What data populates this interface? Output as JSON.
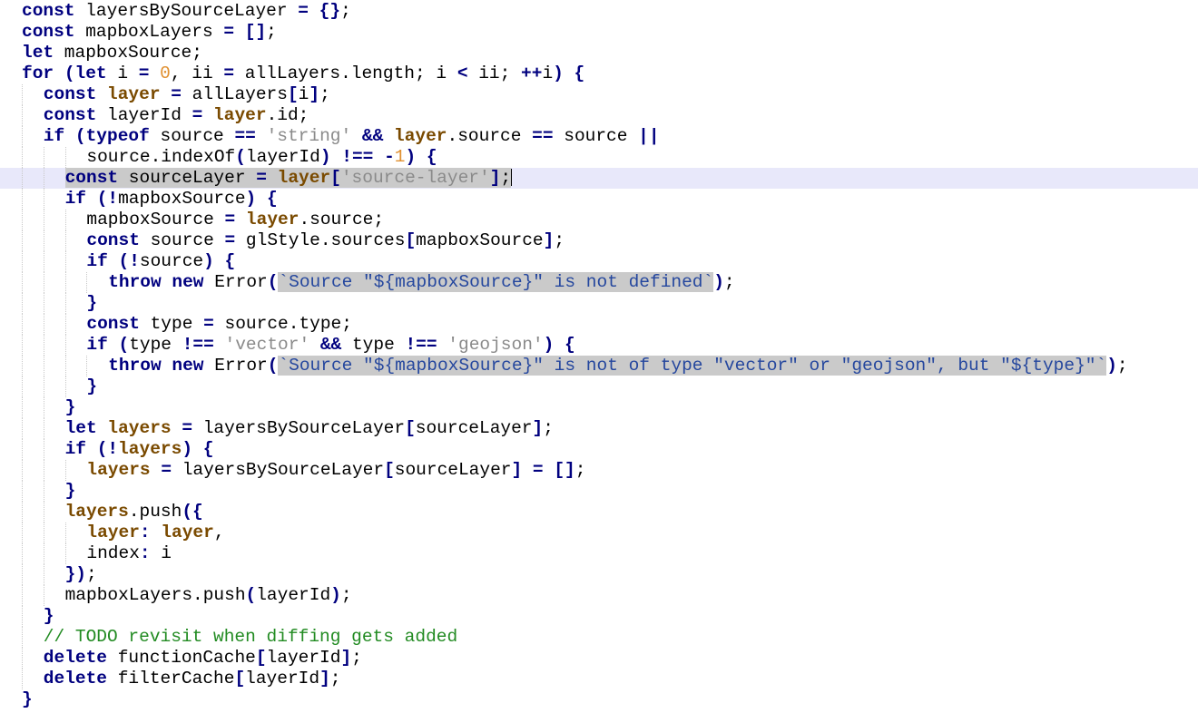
{
  "editor": {
    "current_line": 8,
    "lines": [
      {
        "indent": 0,
        "tokens": [
          [
            "kw",
            "const"
          ],
          [
            "id",
            " layersBySourceLayer "
          ],
          [
            "op",
            "="
          ],
          [
            "pr",
            " "
          ],
          [
            "op",
            "{}"
          ],
          [
            "pr",
            ";"
          ]
        ]
      },
      {
        "indent": 0,
        "tokens": [
          [
            "kw",
            "const"
          ],
          [
            "id",
            " mapboxLayers "
          ],
          [
            "op",
            "="
          ],
          [
            "pr",
            " "
          ],
          [
            "op",
            "[]"
          ],
          [
            "pr",
            ";"
          ]
        ]
      },
      {
        "indent": 0,
        "tokens": [
          [
            "kw",
            "let"
          ],
          [
            "id",
            " mapboxSource"
          ],
          [
            "pr",
            ";"
          ]
        ]
      },
      {
        "indent": 0,
        "tokens": [
          [
            "kw",
            "for"
          ],
          [
            "pr",
            " "
          ],
          [
            "op",
            "("
          ],
          [
            "kw",
            "let"
          ],
          [
            "id",
            " i "
          ],
          [
            "op",
            "="
          ],
          [
            "pr",
            " "
          ],
          [
            "num",
            "0"
          ],
          [
            "pr",
            ", "
          ],
          [
            "id",
            "ii "
          ],
          [
            "op",
            "="
          ],
          [
            "id",
            " allLayers.length"
          ],
          [
            "pr",
            "; "
          ],
          [
            "id",
            "i "
          ],
          [
            "op",
            "<"
          ],
          [
            "id",
            " ii"
          ],
          [
            "pr",
            "; "
          ],
          [
            "op",
            "++"
          ],
          [
            "id",
            "i"
          ],
          [
            "op",
            ")"
          ],
          [
            "pr",
            " "
          ],
          [
            "op",
            "{"
          ]
        ]
      },
      {
        "indent": 1,
        "tokens": [
          [
            "kw",
            "const"
          ],
          [
            "pr",
            " "
          ],
          [
            "bid",
            "layer"
          ],
          [
            "pr",
            " "
          ],
          [
            "op",
            "="
          ],
          [
            "id",
            " allLayers"
          ],
          [
            "op",
            "["
          ],
          [
            "id",
            "i"
          ],
          [
            "op",
            "]"
          ],
          [
            "pr",
            ";"
          ]
        ]
      },
      {
        "indent": 1,
        "tokens": [
          [
            "kw",
            "const"
          ],
          [
            "id",
            " layerId "
          ],
          [
            "op",
            "="
          ],
          [
            "pr",
            " "
          ],
          [
            "bid",
            "layer"
          ],
          [
            "id",
            ".id"
          ],
          [
            "pr",
            ";"
          ]
        ]
      },
      {
        "indent": 1,
        "tokens": [
          [
            "kw",
            "if"
          ],
          [
            "pr",
            " "
          ],
          [
            "op",
            "("
          ],
          [
            "kw",
            "typeof"
          ],
          [
            "id",
            " source "
          ],
          [
            "op",
            "=="
          ],
          [
            "pr",
            " "
          ],
          [
            "str",
            "'string'"
          ],
          [
            "pr",
            " "
          ],
          [
            "op",
            "&&"
          ],
          [
            "pr",
            " "
          ],
          [
            "bid",
            "layer"
          ],
          [
            "id",
            ".source "
          ],
          [
            "op",
            "=="
          ],
          [
            "id",
            " source "
          ],
          [
            "op",
            "||"
          ]
        ]
      },
      {
        "indent": 3,
        "tokens": [
          [
            "id",
            "source.indexOf"
          ],
          [
            "op",
            "("
          ],
          [
            "id",
            "layerId"
          ],
          [
            "op",
            ")"
          ],
          [
            "pr",
            " "
          ],
          [
            "op",
            "!=="
          ],
          [
            "pr",
            " "
          ],
          [
            "op",
            "-"
          ],
          [
            "num",
            "1"
          ],
          [
            "op",
            ")"
          ],
          [
            "pr",
            " "
          ],
          [
            "op",
            "{"
          ]
        ]
      },
      {
        "indent": 2,
        "tokens": [
          [
            "kw hl",
            "const"
          ],
          [
            "id hl",
            " sourceLayer "
          ],
          [
            "op hl",
            "="
          ],
          [
            "pr hl",
            " "
          ],
          [
            "bid hl",
            "layer"
          ],
          [
            "op hl",
            "["
          ],
          [
            "strhl",
            "'source-layer'"
          ],
          [
            "op hl",
            "]"
          ],
          [
            "pr hl",
            ";"
          ],
          [
            "caret",
            ""
          ]
        ]
      },
      {
        "indent": 2,
        "tokens": [
          [
            "kw",
            "if"
          ],
          [
            "pr",
            " "
          ],
          [
            "op",
            "(!"
          ],
          [
            "id",
            "mapboxSource"
          ],
          [
            "op",
            ")"
          ],
          [
            "pr",
            " "
          ],
          [
            "op",
            "{"
          ]
        ]
      },
      {
        "indent": 3,
        "tokens": [
          [
            "id",
            "mapboxSource "
          ],
          [
            "op",
            "="
          ],
          [
            "pr",
            " "
          ],
          [
            "bid",
            "layer"
          ],
          [
            "id",
            ".source"
          ],
          [
            "pr",
            ";"
          ]
        ]
      },
      {
        "indent": 3,
        "tokens": [
          [
            "kw",
            "const"
          ],
          [
            "id",
            " source "
          ],
          [
            "op",
            "="
          ],
          [
            "id",
            " glStyle.sources"
          ],
          [
            "op",
            "["
          ],
          [
            "id",
            "mapboxSource"
          ],
          [
            "op",
            "]"
          ],
          [
            "pr",
            ";"
          ]
        ]
      },
      {
        "indent": 3,
        "tokens": [
          [
            "kw",
            "if"
          ],
          [
            "pr",
            " "
          ],
          [
            "op",
            "(!"
          ],
          [
            "id",
            "source"
          ],
          [
            "op",
            ")"
          ],
          [
            "pr",
            " "
          ],
          [
            "op",
            "{"
          ]
        ]
      },
      {
        "indent": 4,
        "tokens": [
          [
            "kw",
            "throw"
          ],
          [
            "pr",
            " "
          ],
          [
            "kw",
            "new"
          ],
          [
            "id",
            " Error"
          ],
          [
            "op",
            "("
          ],
          [
            "tpl",
            "`Source \"${mapboxSource}\" is not defined`"
          ],
          [
            "op",
            ")"
          ],
          [
            "pr",
            ";"
          ]
        ]
      },
      {
        "indent": 3,
        "tokens": [
          [
            "op",
            "}"
          ]
        ]
      },
      {
        "indent": 3,
        "tokens": [
          [
            "kw",
            "const"
          ],
          [
            "id",
            " type "
          ],
          [
            "op",
            "="
          ],
          [
            "id",
            " source.type"
          ],
          [
            "pr",
            ";"
          ]
        ]
      },
      {
        "indent": 3,
        "tokens": [
          [
            "kw",
            "if"
          ],
          [
            "pr",
            " "
          ],
          [
            "op",
            "("
          ],
          [
            "id",
            "type "
          ],
          [
            "op",
            "!=="
          ],
          [
            "pr",
            " "
          ],
          [
            "str",
            "'vector'"
          ],
          [
            "pr",
            " "
          ],
          [
            "op",
            "&&"
          ],
          [
            "id",
            " type "
          ],
          [
            "op",
            "!=="
          ],
          [
            "pr",
            " "
          ],
          [
            "str",
            "'geojson'"
          ],
          [
            "op",
            ")"
          ],
          [
            "pr",
            " "
          ],
          [
            "op",
            "{"
          ]
        ]
      },
      {
        "indent": 4,
        "tokens": [
          [
            "kw",
            "throw"
          ],
          [
            "pr",
            " "
          ],
          [
            "kw",
            "new"
          ],
          [
            "id",
            " Error"
          ],
          [
            "op",
            "("
          ],
          [
            "tpl",
            "`Source \"${mapboxSource}\" is not of type \"vector\" or \"geojson\", but \"${type}\"`"
          ],
          [
            "op",
            ")"
          ],
          [
            "pr",
            ";"
          ]
        ]
      },
      {
        "indent": 3,
        "tokens": [
          [
            "op",
            "}"
          ]
        ]
      },
      {
        "indent": 2,
        "tokens": [
          [
            "op",
            "}"
          ]
        ]
      },
      {
        "indent": 2,
        "tokens": [
          [
            "kw",
            "let"
          ],
          [
            "pr",
            " "
          ],
          [
            "bid",
            "layers"
          ],
          [
            "pr",
            " "
          ],
          [
            "op",
            "="
          ],
          [
            "id",
            " layersBySourceLayer"
          ],
          [
            "op",
            "["
          ],
          [
            "id",
            "sourceLayer"
          ],
          [
            "op",
            "]"
          ],
          [
            "pr",
            ";"
          ]
        ]
      },
      {
        "indent": 2,
        "tokens": [
          [
            "kw",
            "if"
          ],
          [
            "pr",
            " "
          ],
          [
            "op",
            "(!"
          ],
          [
            "bid",
            "layers"
          ],
          [
            "op",
            ")"
          ],
          [
            "pr",
            " "
          ],
          [
            "op",
            "{"
          ]
        ]
      },
      {
        "indent": 3,
        "tokens": [
          [
            "bid",
            "layers"
          ],
          [
            "pr",
            " "
          ],
          [
            "op",
            "="
          ],
          [
            "id",
            " layersBySourceLayer"
          ],
          [
            "op",
            "["
          ],
          [
            "id",
            "sourceLayer"
          ],
          [
            "op",
            "]"
          ],
          [
            "pr",
            " "
          ],
          [
            "op",
            "="
          ],
          [
            "pr",
            " "
          ],
          [
            "op",
            "[]"
          ],
          [
            "pr",
            ";"
          ]
        ]
      },
      {
        "indent": 2,
        "tokens": [
          [
            "op",
            "}"
          ]
        ]
      },
      {
        "indent": 2,
        "tokens": [
          [
            "bid",
            "layers"
          ],
          [
            "id",
            ".push"
          ],
          [
            "op",
            "({"
          ]
        ]
      },
      {
        "indent": 3,
        "tokens": [
          [
            "bid",
            "layer"
          ],
          [
            "op",
            ":"
          ],
          [
            "pr",
            " "
          ],
          [
            "bid",
            "layer"
          ],
          [
            "pr",
            ","
          ]
        ]
      },
      {
        "indent": 3,
        "tokens": [
          [
            "id",
            "index"
          ],
          [
            "op",
            ":"
          ],
          [
            "id",
            " i"
          ]
        ]
      },
      {
        "indent": 2,
        "tokens": [
          [
            "op",
            "})"
          ],
          [
            "pr",
            ";"
          ]
        ]
      },
      {
        "indent": 2,
        "tokens": [
          [
            "id",
            "mapboxLayers.push"
          ],
          [
            "op",
            "("
          ],
          [
            "id",
            "layerId"
          ],
          [
            "op",
            ")"
          ],
          [
            "pr",
            ";"
          ]
        ]
      },
      {
        "indent": 1,
        "tokens": [
          [
            "op",
            "}"
          ]
        ]
      },
      {
        "indent": 1,
        "tokens": [
          [
            "cm",
            "// TODO revisit when diffing gets added"
          ]
        ]
      },
      {
        "indent": 1,
        "tokens": [
          [
            "kw",
            "delete"
          ],
          [
            "id",
            " functionCache"
          ],
          [
            "op",
            "["
          ],
          [
            "id",
            "layerId"
          ],
          [
            "op",
            "]"
          ],
          [
            "pr",
            ";"
          ]
        ]
      },
      {
        "indent": 1,
        "tokens": [
          [
            "kw",
            "delete"
          ],
          [
            "id",
            " filterCache"
          ],
          [
            "op",
            "["
          ],
          [
            "id",
            "layerId"
          ],
          [
            "op",
            "]"
          ],
          [
            "pr",
            ";"
          ]
        ]
      },
      {
        "indent": 0,
        "tokens": [
          [
            "op",
            "}"
          ]
        ]
      }
    ]
  }
}
